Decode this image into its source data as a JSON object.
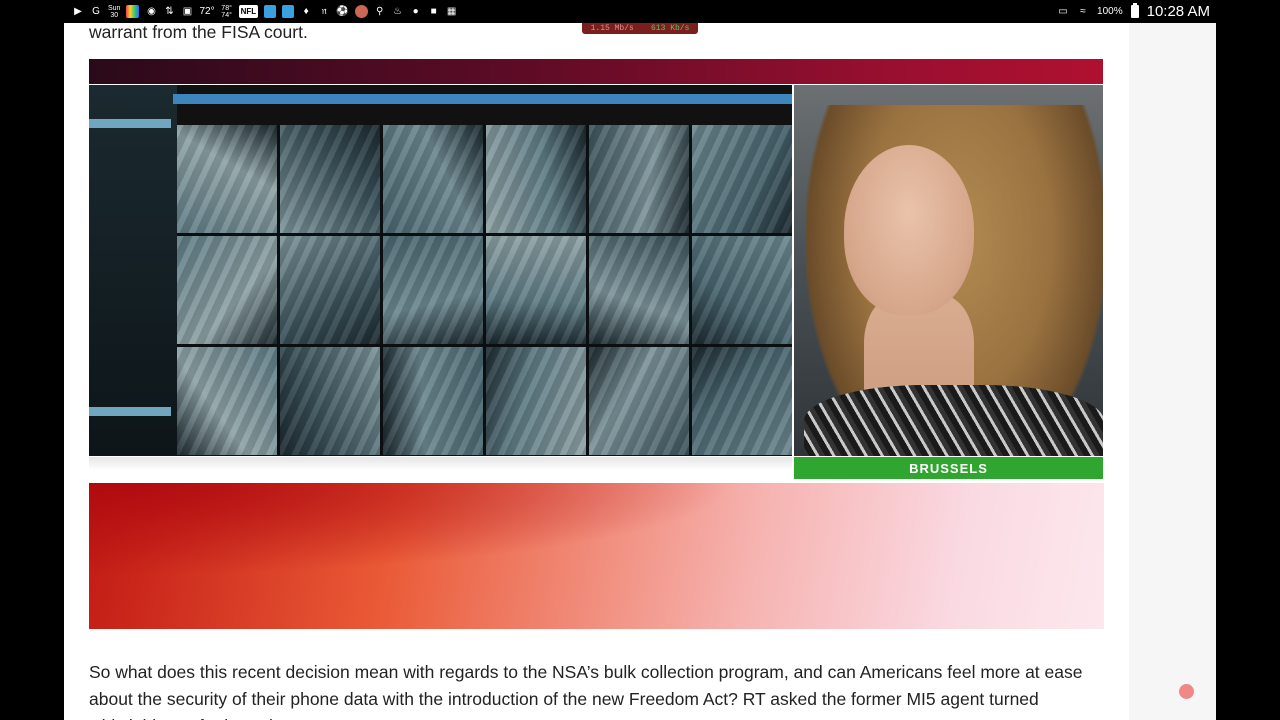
{
  "status_bar": {
    "left_icons": [
      "video-icon",
      "g-icon",
      "calendar-icon",
      "google-photos-icon",
      "chrome-icon",
      "sync-icon",
      "screenshot-icon",
      "weather-icon",
      "weather-alt-icon",
      "nfl-icon",
      "app-icon",
      "app-icon-2",
      "game-icon",
      "news-icon",
      "nyt-icon",
      "soccer-icon",
      "pizza-icon",
      "key-icon",
      "fire-icon",
      "lock-icon",
      "bag-icon",
      "image-icon"
    ],
    "calendar_day": "Sun",
    "calendar_date": "30",
    "temp": "72°",
    "temp2_hi": "78°",
    "temp2_lo": "74°",
    "nfl_label": "NFL",
    "battery_pct": "100%",
    "time": "10:28 AM"
  },
  "speed_overlay": {
    "down": "1.15 Mb/s",
    "up": "613 Kb/s"
  },
  "article": {
    "top_paragraph": "warrant from the FISA court.",
    "bottom_paragraph": "So what does this recent decision mean with regards to the NSA’s bulk collection program, and can Americans feel more at ease about the security of their phone data with the introduction of the new Freedom Act? RT asked the former MI5 agent turned whistleblower for her take."
  },
  "video": {
    "location_label": "BRUSSELS",
    "camera_feeds": 18
  },
  "colors": {
    "topbar_start": "#2a0a1a",
    "topbar_end": "#b01030",
    "location_bar": "#2fa62f",
    "rec_dot": "#f08888"
  }
}
